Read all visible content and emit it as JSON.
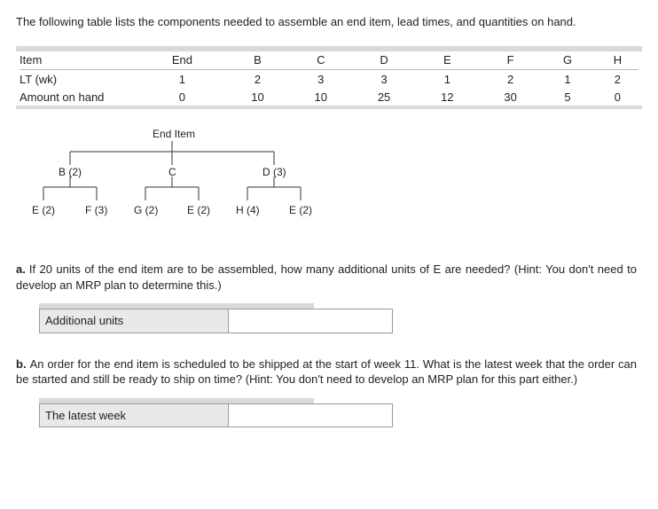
{
  "intro": "The following table lists the components needed to assemble an end item, lead times, and quantities on hand.",
  "table": {
    "row_item": {
      "label": "Item",
      "vals": [
        "End",
        "B",
        "C",
        "D",
        "E",
        "F",
        "G",
        "H"
      ]
    },
    "row_lt": {
      "label": "LT (wk)",
      "vals": [
        "1",
        "2",
        "3",
        "3",
        "1",
        "2",
        "1",
        "2"
      ]
    },
    "row_onhand": {
      "label": "Amount on hand",
      "vals": [
        "0",
        "10",
        "10",
        "25",
        "12",
        "30",
        "5",
        "0"
      ]
    }
  },
  "bom": {
    "root": "End Item",
    "l1": [
      "B (2)",
      "C",
      "D (3)"
    ],
    "l2": [
      "E (2)",
      "F (3)",
      "G (2)",
      "E (2)",
      "H (4)",
      "E (2)"
    ]
  },
  "qa": {
    "prefix": "a.",
    "text": "If 20 units of the end item are to be assembled, how many additional units of E are needed? (Hint: You don't need to develop an MRP plan to determine this.)",
    "label": "Additional units"
  },
  "qb": {
    "prefix": "b.",
    "text": "An order for the end item is scheduled to be shipped at the start of week 11. What is the latest week that the order can be started and still be ready to ship on time? (Hint: You don't need to develop an MRP plan for this part either.)",
    "label": "The latest week"
  },
  "chart_data": {
    "type": "table",
    "title": "Components, lead times, and on-hand quantities",
    "columns": [
      "Item",
      "LT (wk)",
      "Amount on hand"
    ],
    "rows": [
      {
        "Item": "End",
        "LT (wk)": 1,
        "Amount on hand": 0
      },
      {
        "Item": "B",
        "LT (wk)": 2,
        "Amount on hand": 10
      },
      {
        "Item": "C",
        "LT (wk)": 3,
        "Amount on hand": 10
      },
      {
        "Item": "D",
        "LT (wk)": 3,
        "Amount on hand": 25
      },
      {
        "Item": "E",
        "LT (wk)": 1,
        "Amount on hand": 12
      },
      {
        "Item": "F",
        "LT (wk)": 2,
        "Amount on hand": 30
      },
      {
        "Item": "G",
        "LT (wk)": 1,
        "Amount on hand": 5
      },
      {
        "Item": "H",
        "LT (wk)": 2,
        "Amount on hand": 0
      }
    ],
    "bom_tree": {
      "End Item": {
        "B": {
          "qty": 2,
          "children": {
            "E": {
              "qty": 2
            },
            "F": {
              "qty": 3
            }
          }
        },
        "C": {
          "qty": 1,
          "children": {
            "G": {
              "qty": 2
            },
            "E": {
              "qty": 2
            }
          }
        },
        "D": {
          "qty": 3,
          "children": {
            "H": {
              "qty": 4
            },
            "E": {
              "qty": 2
            }
          }
        }
      }
    }
  }
}
